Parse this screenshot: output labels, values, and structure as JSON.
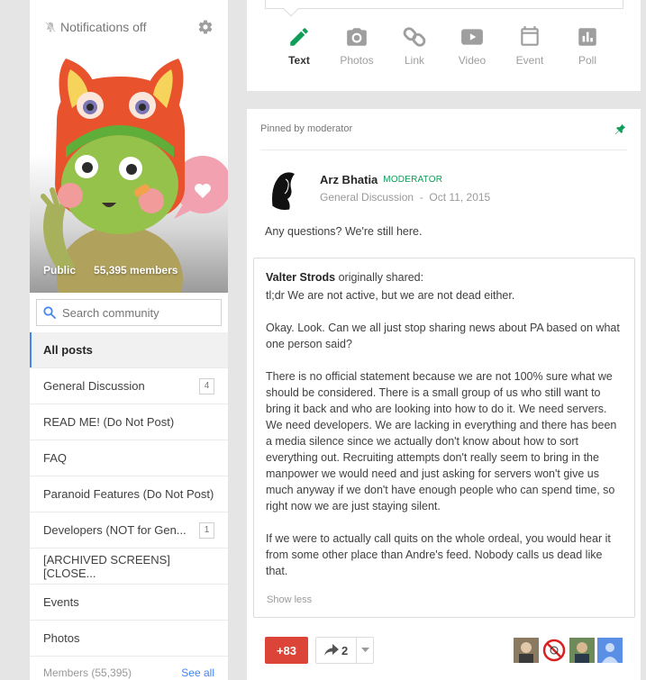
{
  "sidebar": {
    "notifications_label": "Notifications off",
    "visibility": "Public",
    "member_count": "55,395 members",
    "search_placeholder": "Search community",
    "nav": [
      {
        "label": "All posts",
        "count": ""
      },
      {
        "label": "General Discussion",
        "count": "4"
      },
      {
        "label": "READ ME! (Do Not Post)",
        "count": ""
      },
      {
        "label": "FAQ",
        "count": ""
      },
      {
        "label": "Paranoid Features (Do Not Post)",
        "count": ""
      },
      {
        "label": "Developers (NOT for Gen...",
        "count": "1"
      },
      {
        "label": "[ARCHIVED SCREENS] [CLOSE...",
        "count": ""
      },
      {
        "label": "Events",
        "count": ""
      },
      {
        "label": "Photos",
        "count": ""
      }
    ],
    "members_label": "Members (55,395)",
    "see_all": "See all"
  },
  "share": {
    "tools": [
      "Text",
      "Photos",
      "Link",
      "Video",
      "Event",
      "Poll"
    ]
  },
  "post": {
    "pinned_label": "Pinned by moderator",
    "author": "Arz Bhatia",
    "role": "MODERATOR",
    "category": "General Discussion",
    "date": "Oct 11, 2015",
    "text": "Any questions? We're still here.",
    "shared_author": "Valter Strods",
    "shared_suffix": "originally shared:",
    "paragraphs": [
      "tl;dr We are not active, but we are not dead either.",
      "Okay. Look. Can we all just stop sharing news about PA based on what one person said?",
      "There is no official statement because we are not 100% sure what we should be considered. There is a small group of us who still want to bring it back and who are looking into how to do it. We need servers. We need developers. We are lacking in everything and there has been a media silence since we actually don't know about how to sort everything out. Recruiting attempts don't really seem to bring in the manpower we would need and just asking for servers won't give us much anyway if we don't have enough people who can spend time, so right now we are just staying silent.",
      "If we were to actually call quits on the whole ordeal, you would hear it from some other place than Andre's feed. Nobody calls us dead like that."
    ],
    "show_less": "Show less",
    "plus_count": "+83",
    "reshare_count": "2"
  },
  "colors": {
    "accent_blue": "#4285f4",
    "plus_red": "#db4437",
    "moderator_green": "#0f9d58"
  }
}
